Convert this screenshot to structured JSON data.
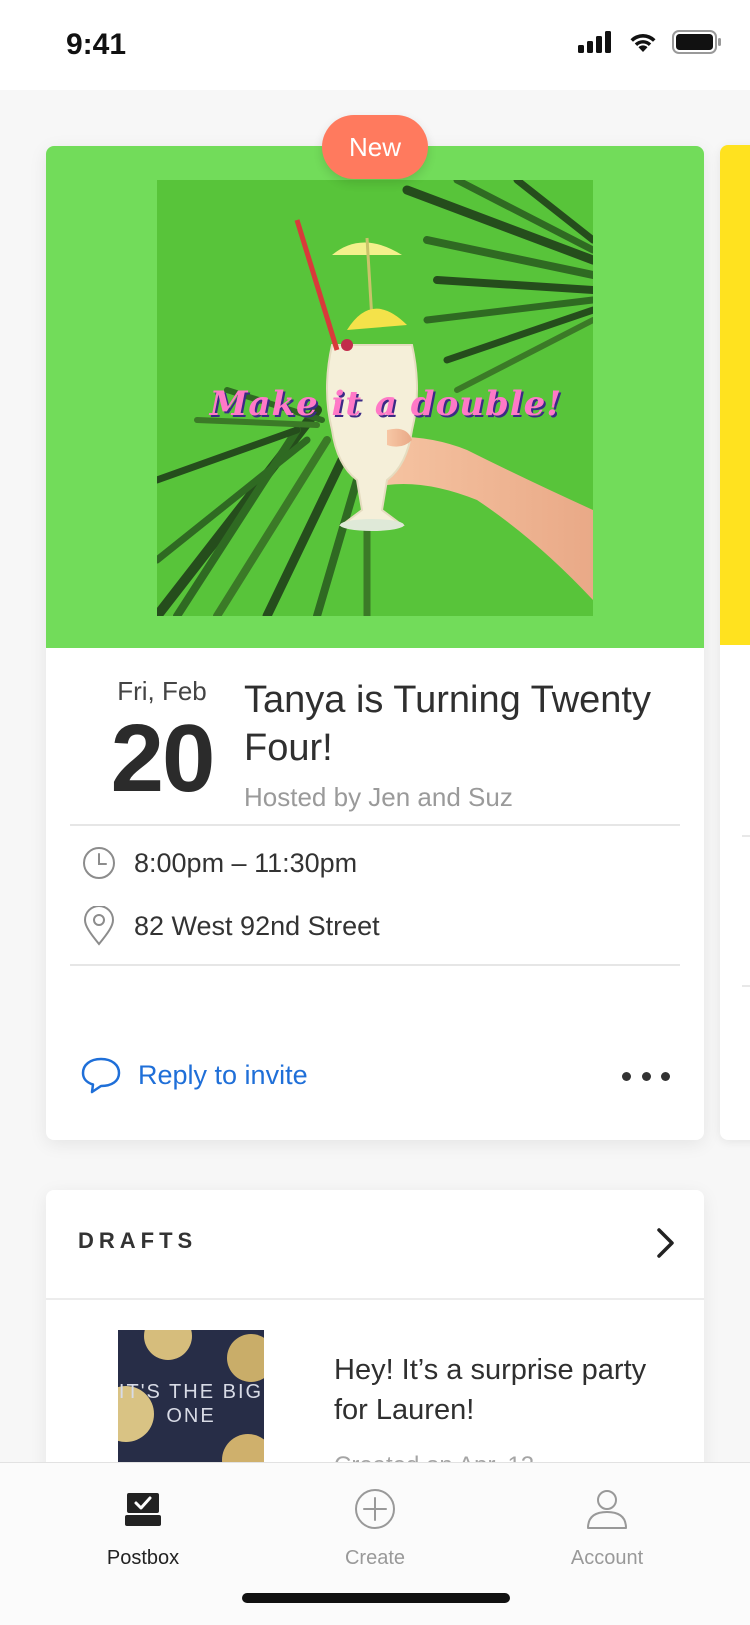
{
  "status_bar": {
    "time": "9:41"
  },
  "event_card": {
    "badge": "New",
    "hero_text": "Make it a double!",
    "day_line": "Fri, Feb",
    "day_number": "20",
    "title": "Tanya is Turning Twenty Four!",
    "host": "Hosted by Jen and Suz",
    "time_range": "8:00pm – 11:30pm",
    "address": "82 West 92nd Street",
    "reply_label": "Reply to invite"
  },
  "drafts": {
    "header": "DRAFTS",
    "item": {
      "thumb_text": "IT'S THE BIG ONE",
      "title": "Hey! It’s a surprise party for Lauren!",
      "subtitle": "Created on Apr. 12"
    }
  },
  "tabs": [
    {
      "label": "Postbox",
      "icon": "postbox-icon",
      "active": true
    },
    {
      "label": "Create",
      "icon": "plus-circle-icon",
      "active": false
    },
    {
      "label": "Account",
      "icon": "person-icon",
      "active": false
    }
  ],
  "colors": {
    "hero_bg": "#72dc5a",
    "badge_bg": "#ff7a5e",
    "link": "#1f6fd8",
    "peek_card": "#ffe21f"
  }
}
